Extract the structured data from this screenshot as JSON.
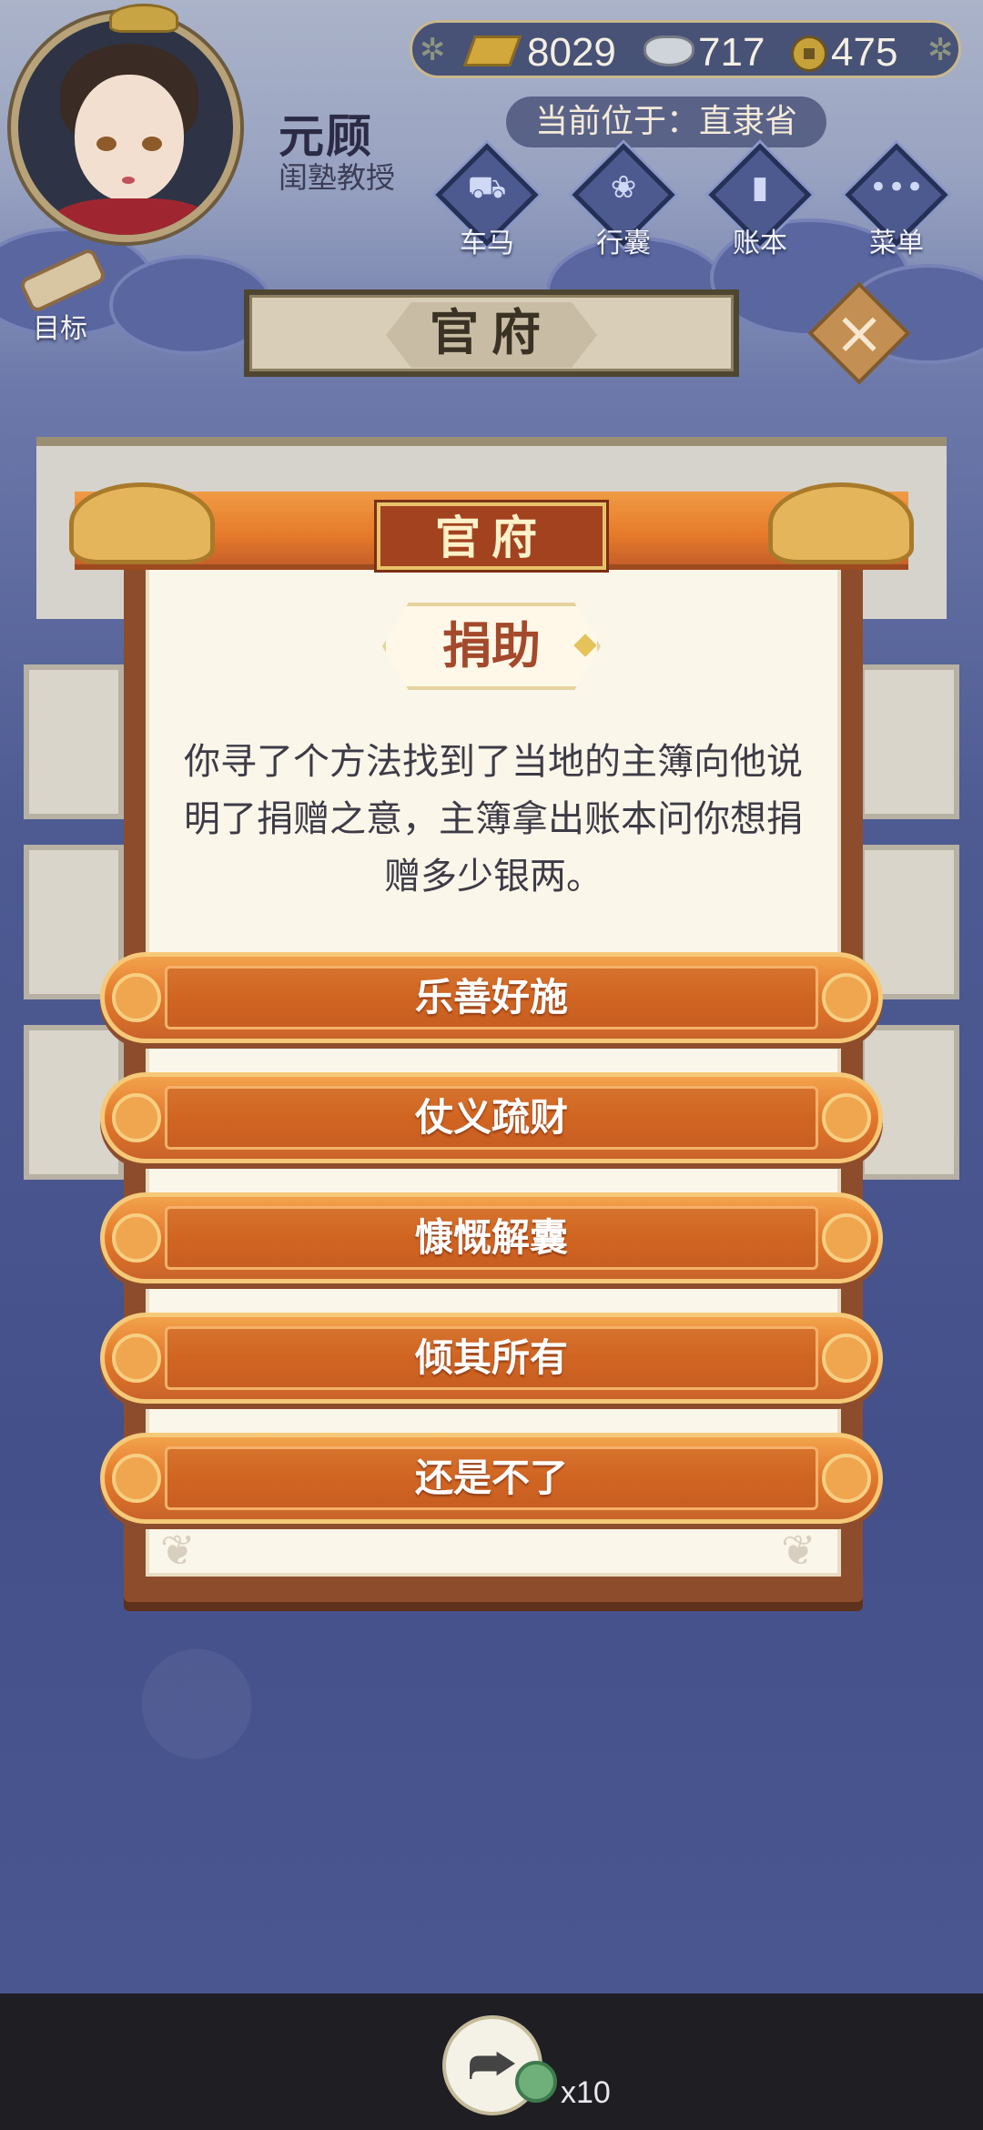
{
  "header": {
    "player_name": "元顾",
    "player_title": "闺塾教授",
    "location": "当前位于：直隶省"
  },
  "currency": {
    "gold": "8029",
    "silver": "717",
    "coins": "475"
  },
  "nav": [
    {
      "label": "车马",
      "icon": "carriage-icon"
    },
    {
      "label": "行囊",
      "icon": "bag-icon"
    },
    {
      "label": "账本",
      "icon": "ledger-icon"
    },
    {
      "label": "菜单",
      "icon": "menu-icon"
    }
  ],
  "goal_label": "目标",
  "scene_title": "官府",
  "modal": {
    "title": "官府",
    "subtitle": "捐助",
    "description": "你寻了个方法找到了当地的主簿向他说明了捐赠之意，主簿拿出账本问你想捐赠多少银两。",
    "options": [
      "乐善好施",
      "仗义疏财",
      "慷慨解囊",
      "倾其所有",
      "还是不了"
    ]
  },
  "bottom": {
    "share_count": "x10"
  },
  "colors": {
    "accent_orange": "#e3782b",
    "modal_frame": "#8d4d2c",
    "background_blue": "#4e5b93"
  }
}
